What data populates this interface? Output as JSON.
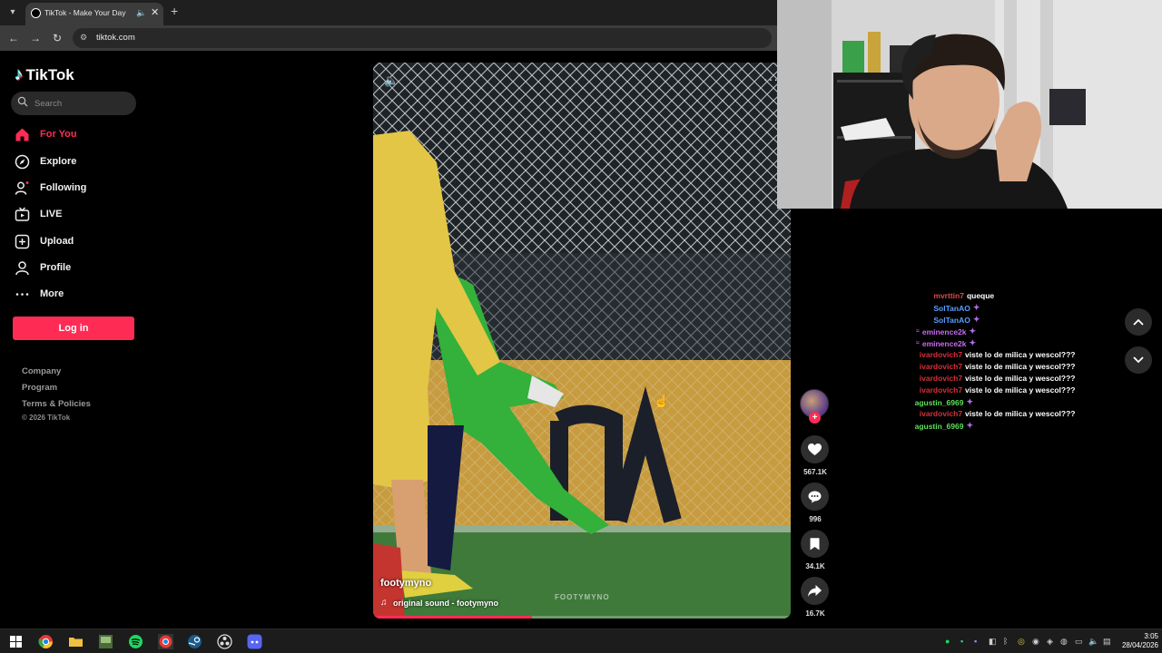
{
  "browser": {
    "tab_title": "TikTok - Make Your Day",
    "url": "tiktok.com"
  },
  "sidebar": {
    "logo_text": "TikTok",
    "search_placeholder": "Search",
    "items": [
      {
        "label": "For You",
        "icon": "home-icon",
        "active": true
      },
      {
        "label": "Explore",
        "icon": "compass-icon"
      },
      {
        "label": "Following",
        "icon": "following-icon"
      },
      {
        "label": "LIVE",
        "icon": "live-icon"
      },
      {
        "label": "Upload",
        "icon": "upload-icon"
      },
      {
        "label": "Profile",
        "icon": "profile-icon"
      },
      {
        "label": "More",
        "icon": "more-icon"
      }
    ],
    "login_label": "Log in",
    "footer_links": [
      "Company",
      "Program",
      "Terms & Policies"
    ],
    "copyright": "© 2026 TikTok"
  },
  "video": {
    "author": "footymyno",
    "sound": "original sound - footymyno",
    "watermark": "FOOTYMYNO",
    "progress": 0.38
  },
  "actions": {
    "likes": "567.1K",
    "comments": "996",
    "saves": "34.1K",
    "shares": "16.7K"
  },
  "chat": [
    {
      "user": "mvrttin7",
      "color": "#e04a4a",
      "msg": "queque"
    },
    {
      "user": "SolTanAO",
      "color": "#5aa0ff",
      "msg": "",
      "emote": true
    },
    {
      "user": "SolTanAO",
      "color": "#5aa0ff",
      "msg": "",
      "emote": true
    },
    {
      "user": "eminence2k",
      "color": "#c86cf0",
      "msg": "",
      "emote": true,
      "badge": true
    },
    {
      "user": "eminence2k",
      "color": "#c86cf0",
      "msg": "",
      "emote": true,
      "badge": true
    },
    {
      "user": "ivardovich7",
      "color": "#d6303a",
      "msg": "viste lo de milica y wescol???"
    },
    {
      "user": "ivardovich7",
      "color": "#d6303a",
      "msg": "viste lo de milica y wescol???"
    },
    {
      "user": "ivardovich7",
      "color": "#d6303a",
      "msg": "viste lo de milica y wescol???"
    },
    {
      "user": "ivardovich7",
      "color": "#d6303a",
      "msg": "viste lo de milica y wescol???"
    },
    {
      "user": "agustin_6969",
      "color": "#5ee05a",
      "msg": "",
      "emote": true
    },
    {
      "user": "ivardovich7",
      "color": "#d6303a",
      "msg": "viste lo de milica y wescol???"
    },
    {
      "user": "agustin_6969",
      "color": "#5ee05a",
      "msg": "",
      "emote": true
    }
  ],
  "taskbar": {
    "time": "3:05",
    "date": "28/04/2026"
  },
  "colors": {
    "accent": "#fe2c55",
    "background": "#000000"
  }
}
